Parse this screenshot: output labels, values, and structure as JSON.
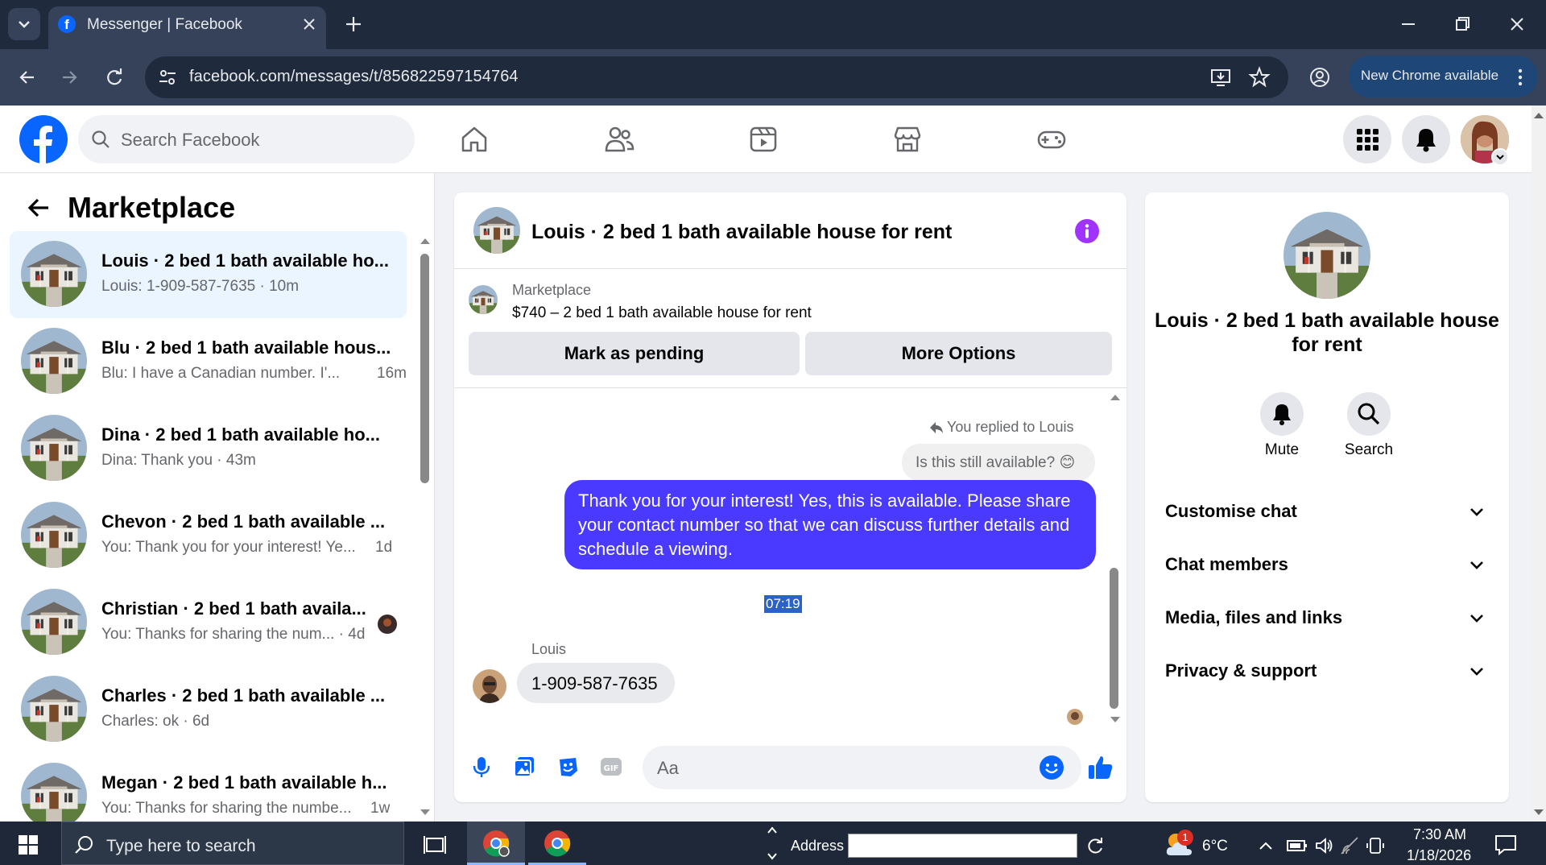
{
  "browser": {
    "tab_title": "Messenger | Facebook",
    "url": "facebook.com/messages/t/856822597154764",
    "new_chrome": "New Chrome available"
  },
  "fb": {
    "search_placeholder": "Search Facebook",
    "brand_color": "#0866ff"
  },
  "left": {
    "title": "Marketplace",
    "conversations": [
      {
        "title": "Louis · 2 bed 1 bath available ho...",
        "preview": "Louis: 1-909-587-7635 · 10m",
        "time": "",
        "active": true
      },
      {
        "title": "Blu · 2 bed 1 bath available hous...",
        "preview": "Blu: I have a Canadian number. I'...",
        "time": "16m"
      },
      {
        "title": "Dina · 2 bed 1 bath available ho...",
        "preview": "Dina: Thank you · 43m",
        "time": ""
      },
      {
        "title": "Chevon · 2 bed 1 bath available ...",
        "preview": "You: Thank you for your interest! Ye...",
        "time": "1d"
      },
      {
        "title": "Christian · 2 bed 1 bath availa...",
        "preview": "You: Thanks for sharing the num... · 4d",
        "time": ""
      },
      {
        "title": "Charles · 2 bed 1 bath available ...",
        "preview": "Charles: ok · 6d",
        "time": ""
      },
      {
        "title": "Megan · 2 bed 1 bath available h...",
        "preview": "You: Thanks for sharing the numbe...",
        "time": "1w"
      }
    ]
  },
  "chat": {
    "title": "Louis · 2 bed 1 bath available house for rent",
    "marketplace_label": "Marketplace",
    "listing": "$740 – 2 bed 1 bath available house for rent",
    "mark_pending": "Mark as pending",
    "more_options": "More Options",
    "replied_to": "You replied to Louis",
    "quoted": "Is this still available? 😊",
    "outgoing": "Thank you for your interest! Yes, this is available. Please share your contact number so that we can discuss further details and schedule a viewing.",
    "time": "07:19",
    "sender": "Louis",
    "incoming": "1-909-587-7635",
    "composer_placeholder": "Aa",
    "accent": "#4a3aff"
  },
  "right": {
    "title": "Louis · 2 bed 1 bath available house for rent",
    "mute": "Mute",
    "search": "Search",
    "sections": [
      "Customise chat",
      "Chat members",
      "Media, files and links",
      "Privacy & support"
    ]
  },
  "taskbar": {
    "search_placeholder": "Type here to search",
    "address_label": "Address",
    "weather": "6°C",
    "weather_badge": "1",
    "time": "7:30 AM",
    "date": "1/18/2026"
  }
}
